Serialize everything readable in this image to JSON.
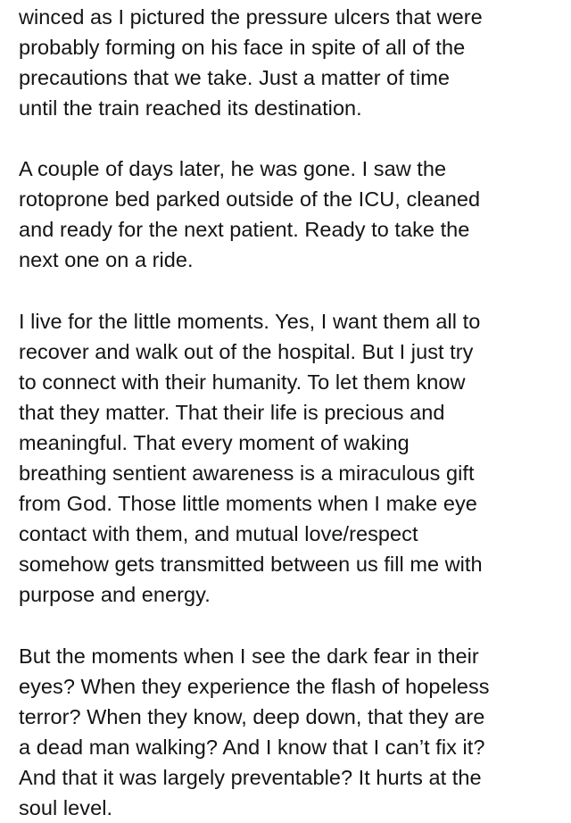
{
  "document": {
    "paragraphs": [
      {
        "lines": [
          "winced as I pictured the pressure ulcers that were",
          "probably forming on his face in spite of all of the",
          "precautions that we take. Just a matter of time",
          "until the train reached its destination."
        ]
      },
      {
        "lines": [
          "A couple of days later, he was gone. I saw the",
          "rotoprone bed parked outside of the ICU, cleaned",
          "and ready for the next patient. Ready to take the",
          "next one on a ride."
        ]
      },
      {
        "lines": [
          "I live for the little moments. Yes, I want them all to",
          "recover and walk out of the hospital. But I just try",
          "to connect with their humanity. To let them know",
          "that they matter. That their life is precious and",
          "meaningful. That every moment of waking",
          "breathing sentient awareness is a miraculous gift",
          "from God. Those little moments when I make eye",
          "contact with them, and mutual love/respect",
          "somehow gets transmitted between us fill me with",
          "purpose and energy."
        ]
      },
      {
        "lines": [
          "But the moments when I see the dark fear in their",
          "eyes? When they experience the flash of hopeless",
          "terror? When they know, deep down, that they are",
          "a dead man walking? And I know that I can’t fix it?",
          "And that it was largely preventable? It hurts at the",
          "soul level."
        ]
      }
    ]
  }
}
